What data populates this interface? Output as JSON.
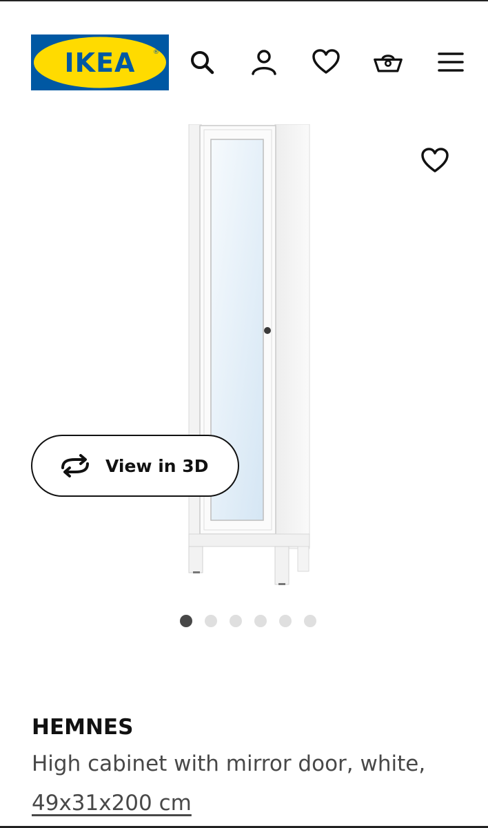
{
  "header": {
    "logo_text": "IKEA",
    "logo_reg": "®",
    "icons": [
      "search-icon",
      "account-icon",
      "wishlist-icon",
      "cart-icon",
      "menu-icon"
    ],
    "brand_blue": "#0058a3",
    "brand_yellow": "#ffdb00"
  },
  "gallery": {
    "favourite_icon": "heart-icon",
    "view3d_label": "View in 3D",
    "view3d_icon": "rotate-3d-icon",
    "image_count": 6,
    "active_image": 1
  },
  "product": {
    "name": "HEMNES",
    "description": "High cabinet with mirror door, white,",
    "dimensions": "49x31x200 cm"
  }
}
